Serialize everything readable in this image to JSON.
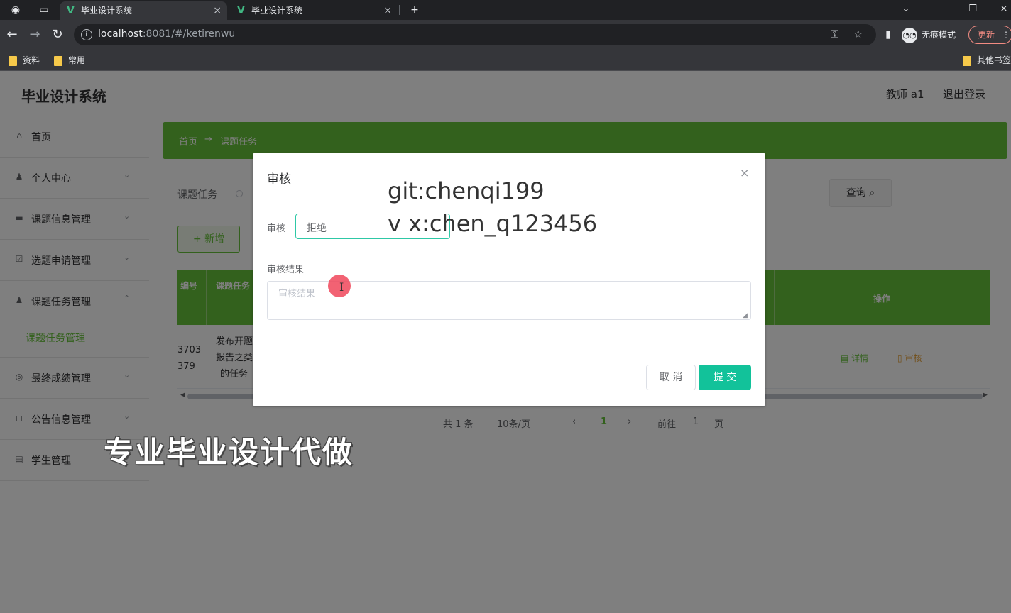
{
  "browser": {
    "tabs": [
      {
        "label": "毕业设计系统"
      },
      {
        "label": "毕业设计系统"
      }
    ],
    "url_host": "localhost",
    "url_rest": ":8081/#/ketirenwu",
    "incognito_label": "无痕模式",
    "update_label": "更新",
    "bookmarks": [
      "资料",
      "常用"
    ],
    "other_bookmarks": "其他书签",
    "icons": {
      "back": "←",
      "forward": "→",
      "reload": "↻",
      "new_tab": "+",
      "close": "×",
      "key": "⚿",
      "star": "☆",
      "sidebar": "▮",
      "menu": "⋮",
      "minimize": "–",
      "restore": "❐",
      "chevron": "⌄"
    }
  },
  "app": {
    "title": "毕业设计系统",
    "user": "教师 a1",
    "logout": "退出登录",
    "sidebar": [
      {
        "label": "首页",
        "icon": "⌂"
      },
      {
        "label": "个人中心",
        "icon": "♟"
      },
      {
        "label": "课题信息管理",
        "icon": "▬"
      },
      {
        "label": "选题申请管理",
        "icon": "☑"
      },
      {
        "label": "课题任务管理",
        "icon": "♟"
      },
      {
        "label": "最终成绩管理",
        "icon": "◎"
      },
      {
        "label": "公告信息管理",
        "icon": "◻"
      },
      {
        "label": "学生管理",
        "icon": "▤"
      }
    ],
    "sub_item": "课题任务管理",
    "breadcrumb": {
      "home": "首页",
      "arrow": "→",
      "current": "课题任务"
    },
    "search": {
      "label": "课题任务",
      "query_button": "查询"
    },
    "add_button": "新增",
    "table": {
      "headers": [
        "编号",
        "课题任务",
        "操作"
      ],
      "row": {
        "id_lines": [
          "3703",
          "379"
        ],
        "task_lines": [
          "发布开题",
          "报告之类",
          "的任务"
        ],
        "actions": [
          "详情",
          "审核"
        ]
      }
    },
    "pagination": {
      "total": "共 1 条",
      "page_size": "10条/页",
      "prev": "‹",
      "current": "1",
      "next": "›",
      "goto_label": "前往",
      "goto_value": "1",
      "page_suffix": "页"
    },
    "overlay_banner": "专业毕业设计代做"
  },
  "dialog": {
    "title": "审核",
    "close": "×",
    "field_label": "审核",
    "select_value": "拒绝",
    "result_label": "审核结果",
    "result_placeholder": "审核结果",
    "cancel": "取 消",
    "submit": "提 交",
    "watermark_line1": "git:chenqi199",
    "watermark_line2": "v x:chen_q123456"
  },
  "colors": {
    "accent_green": "#67c23a",
    "submit_teal": "#12c29a",
    "overlay": "rgba(0,0,0,0.5)"
  }
}
